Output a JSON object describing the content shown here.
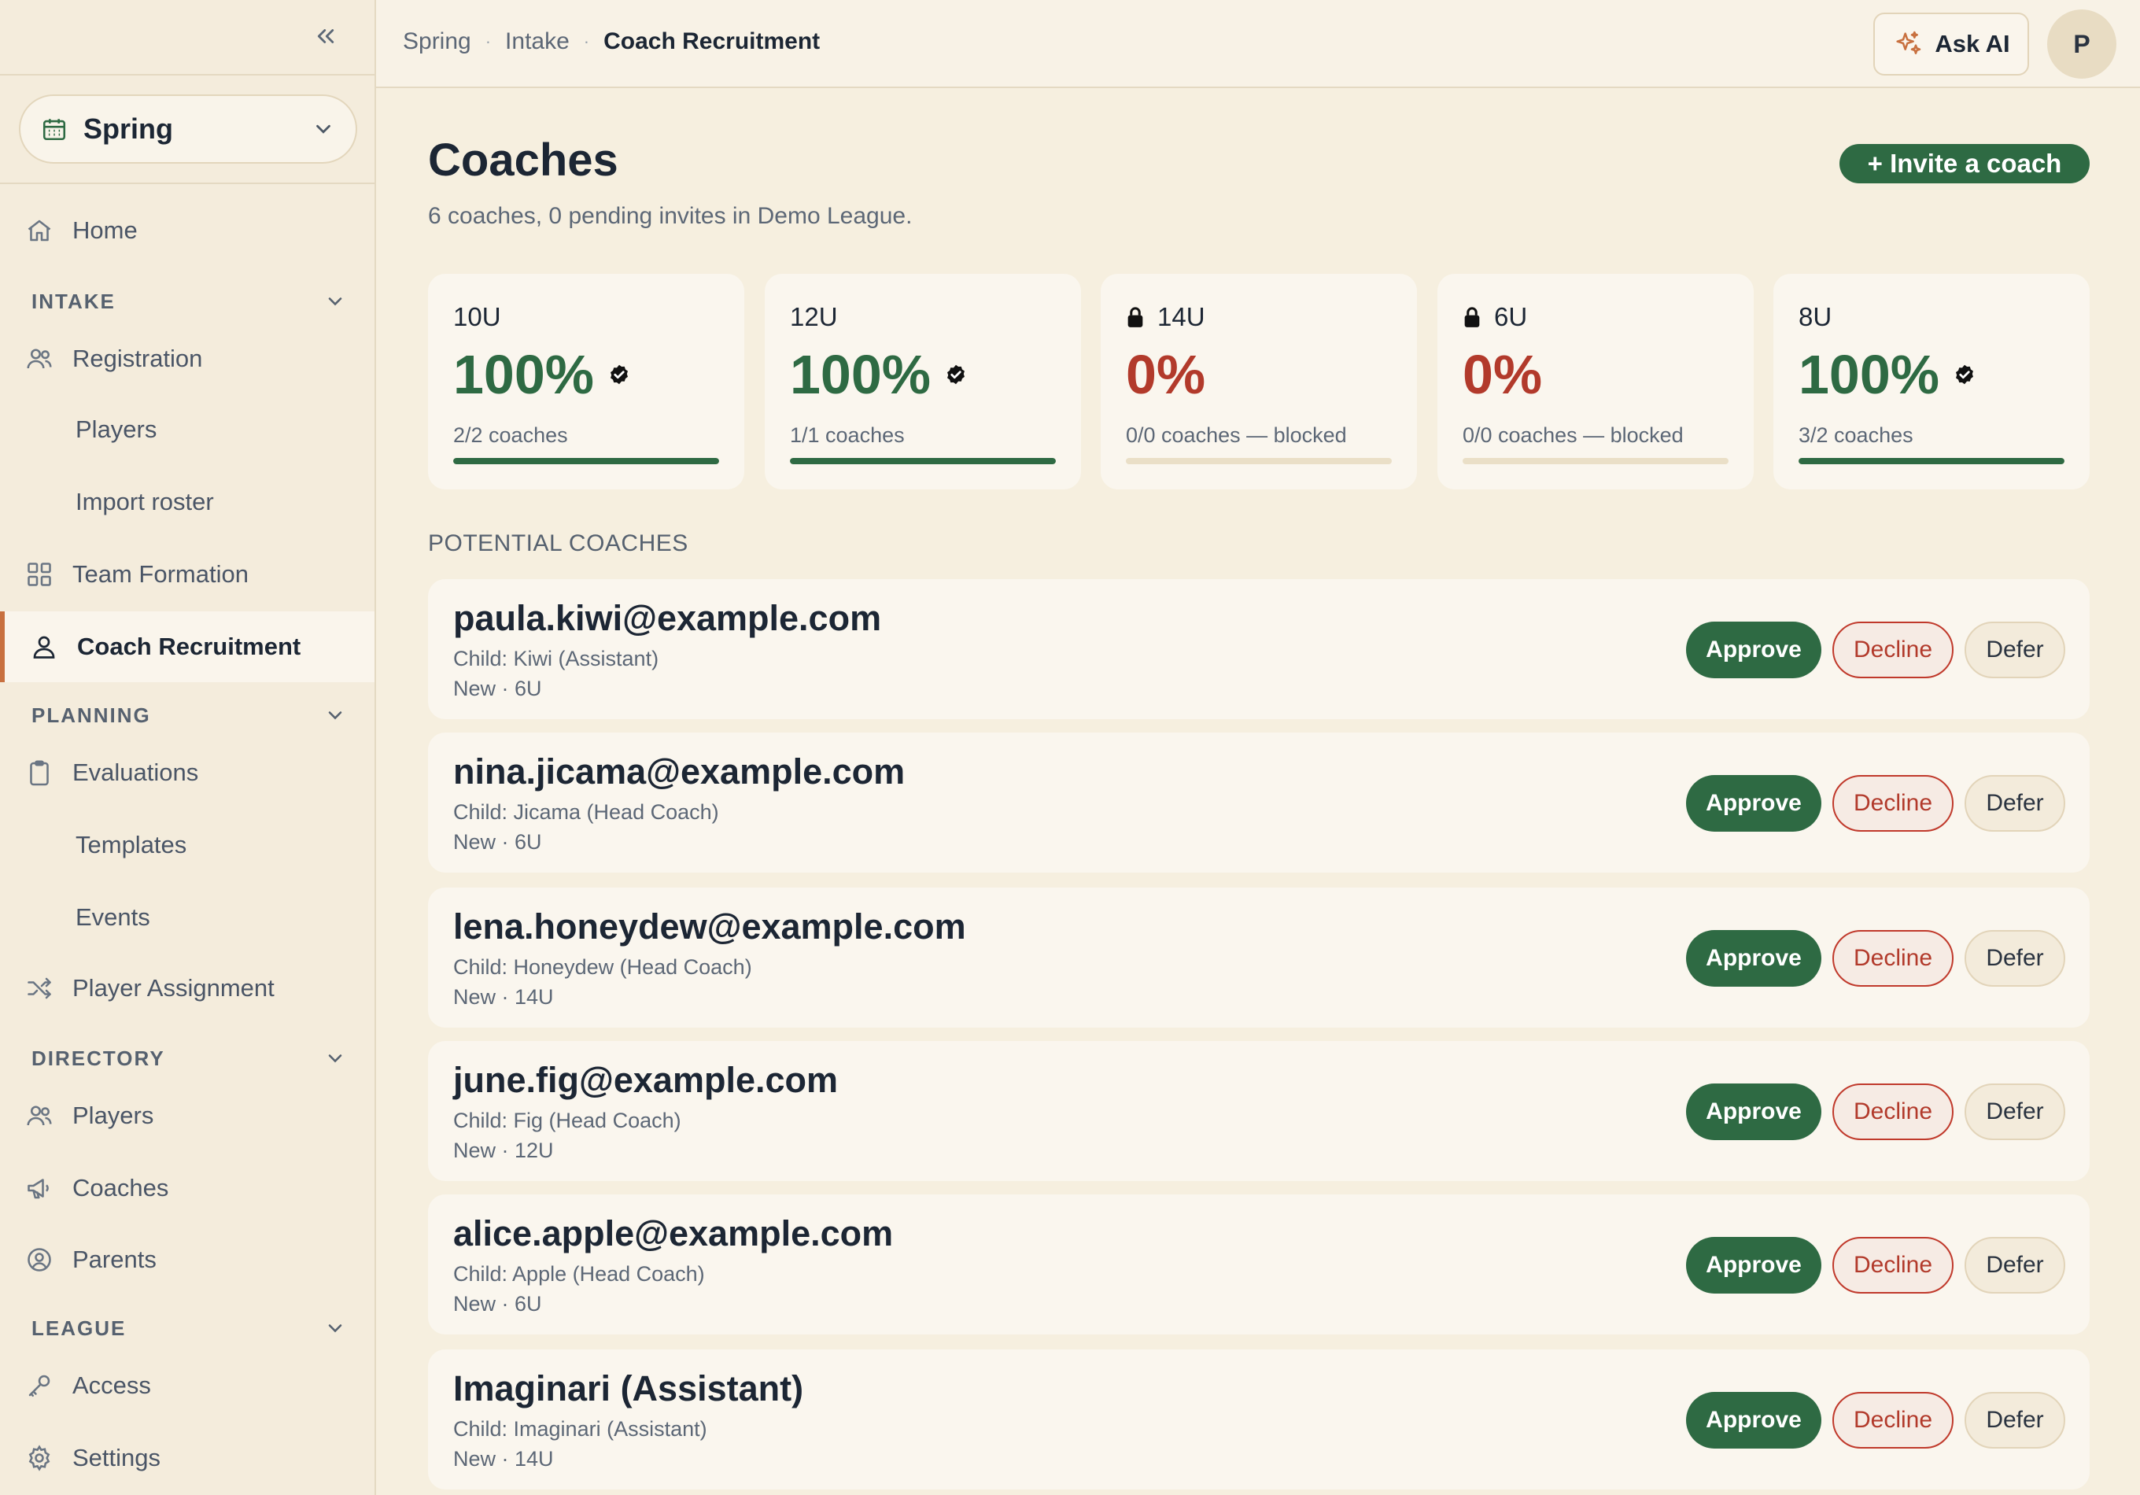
{
  "breadcrumb": [
    "Spring",
    "Intake",
    "Coach Recruitment"
  ],
  "header": {
    "ask_ai": "Ask AI",
    "avatar_initial": "P"
  },
  "season": {
    "selected": "Spring"
  },
  "sidebar": {
    "home": "Home",
    "intake": {
      "title": "INTAKE",
      "registration": "Registration",
      "players": "Players",
      "import_roster": "Import roster",
      "team_formation": "Team Formation",
      "coach_recruitment": "Coach Recruitment"
    },
    "planning": {
      "title": "PLANNING",
      "evaluations": "Evaluations",
      "templates": "Templates",
      "events": "Events",
      "player_assignment": "Player Assignment"
    },
    "directory": {
      "title": "DIRECTORY",
      "players": "Players",
      "coaches": "Coaches",
      "parents": "Parents"
    },
    "league": {
      "title": "LEAGUE",
      "access": "Access",
      "settings": "Settings"
    }
  },
  "main": {
    "title": "Coaches",
    "subtitle": "6 coaches, 0 pending invites in Demo League.",
    "invite_button": "+ Invite a coach",
    "section_label": "POTENTIAL COACHES"
  },
  "stats": [
    {
      "age": "10U",
      "locked": false,
      "percent": "100%",
      "complete": true,
      "coaches": "2/2 coaches",
      "fill": 1.0
    },
    {
      "age": "12U",
      "locked": false,
      "percent": "100%",
      "complete": true,
      "coaches": "1/1 coaches",
      "fill": 1.0
    },
    {
      "age": "14U",
      "locked": true,
      "percent": "0%",
      "complete": false,
      "coaches": "0/0 coaches — blocked",
      "fill": 0.0
    },
    {
      "age": "6U",
      "locked": true,
      "percent": "0%",
      "complete": false,
      "coaches": "0/0 coaches — blocked",
      "fill": 0.0
    },
    {
      "age": "8U",
      "locked": false,
      "percent": "100%",
      "complete": true,
      "coaches": "3/2 coaches",
      "fill": 1.0
    }
  ],
  "coaches": [
    {
      "email": "paula.kiwi@example.com",
      "child": "Child: Kiwi (Assistant)",
      "meta": "New · 6U"
    },
    {
      "email": "nina.jicama@example.com",
      "child": "Child: Jicama (Head Coach)",
      "meta": "New · 6U"
    },
    {
      "email": "lena.honeydew@example.com",
      "child": "Child: Honeydew (Head Coach)",
      "meta": "New · 14U"
    },
    {
      "email": "june.fig@example.com",
      "child": "Child: Fig (Head Coach)",
      "meta": "New · 12U"
    },
    {
      "email": "alice.apple@example.com",
      "child": "Child: Apple (Head Coach)",
      "meta": "New · 6U"
    },
    {
      "email": "Imaginari (Assistant)",
      "child": "Child: Imaginari (Assistant)",
      "meta": "New · 14U"
    }
  ],
  "actions": {
    "approve": "Approve",
    "decline": "Decline",
    "defer": "Defer"
  },
  "colors": {
    "accent_green": "#2e6a43",
    "danger_red": "#b23a2b",
    "active_marker": "#c8703f",
    "background": "#f6efdf"
  }
}
